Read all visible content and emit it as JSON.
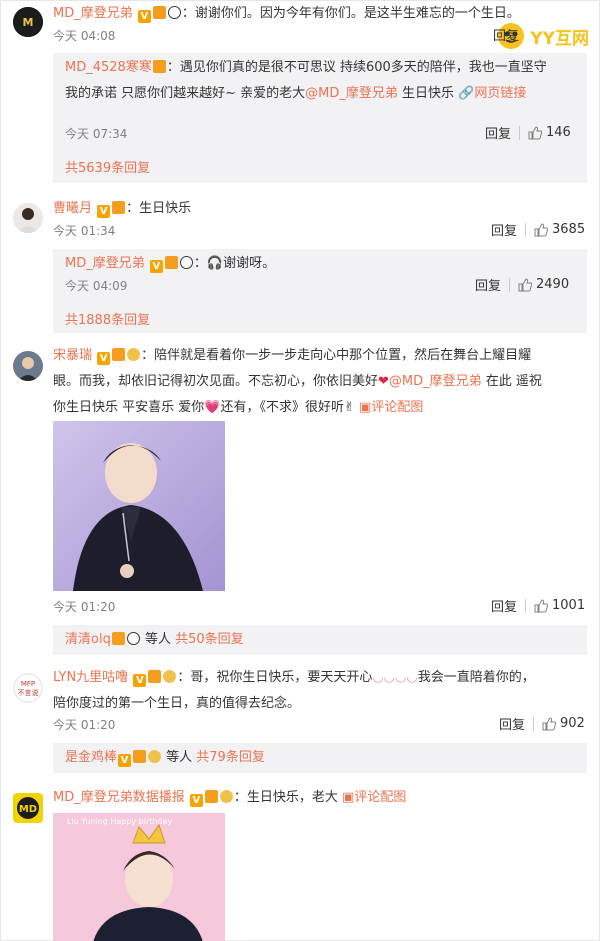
{
  "comments": [
    {
      "name": "MD_摩登兄弟",
      "text": "：谢谢你们。因为今年有你们。是这半生难忘的一个生日。",
      "time": "今天 04:08",
      "reply_label": "回复",
      "replies": [
        {
          "name": "MD_4528寒寒",
          "text_a": "：遇见你们真的是很不可思议 持续600多天的陪伴，我也一直坚守",
          "text_b": "我的承诺 只愿你们越来越好~ 亲爱的老大",
          "mention": "@MD_摩登兄弟",
          "text_c": " 生日快乐",
          "link": "网页链接",
          "time": "今天 07:34",
          "reply_label": "回复",
          "likes": "146"
        }
      ],
      "more": "共5639条回复"
    },
    {
      "name": "曹曦月",
      "text": "：生日快乐",
      "time": "今天 01:34",
      "reply_label": "回复",
      "likes": "3685",
      "replies": [
        {
          "name": "MD_摩登兄弟",
          "text": "谢谢呀。",
          "time": "今天 04:09",
          "reply_label": "回复",
          "likes": "2490"
        }
      ],
      "more": "共1888条回复"
    },
    {
      "name": "宋暴瑞",
      "text_a": "：陪伴就是看着你一步一步走向心中那个位置，然后在舞台上耀目耀",
      "text_b": "眼。而我，却依旧记得初次见面。不忘初心，你依旧美好",
      "mention": "@MD_摩登兄弟",
      "text_c": " 在此  遥祝",
      "text_d": "你生日快乐  平安喜乐  爱你",
      "text_e": "还有，《不求》很好听",
      "link": "评论配图",
      "time": "今天 01:20",
      "reply_label": "回复",
      "likes": "1001",
      "sub_name": "清清olq",
      "sub_text": " 等人 ",
      "more": "共50条回复"
    },
    {
      "name": "LYN九里咕噜",
      "text_a": "：哥，祝你生日快乐，要天天开心",
      "text_a2": "我会一直陪着你的，",
      "text_b": "陪你度过的第一个生日，真的值得去纪念。",
      "time": "今天 01:20",
      "reply_label": "回复",
      "likes": "902",
      "sub_name": "是金鸡棒",
      "sub_text": " 等人 ",
      "more": "共79条回复"
    },
    {
      "name": "MD_摩登兄弟数据播报",
      "text": "：生日快乐，老大",
      "link": "评论配图",
      "photo_caption": "Liu Yuning Happy birthday"
    }
  ],
  "watermark": "YY互网",
  "colors": {
    "accent": "#eb7350",
    "reply_bg": "#f2f2f5",
    "meta": "#808080"
  }
}
